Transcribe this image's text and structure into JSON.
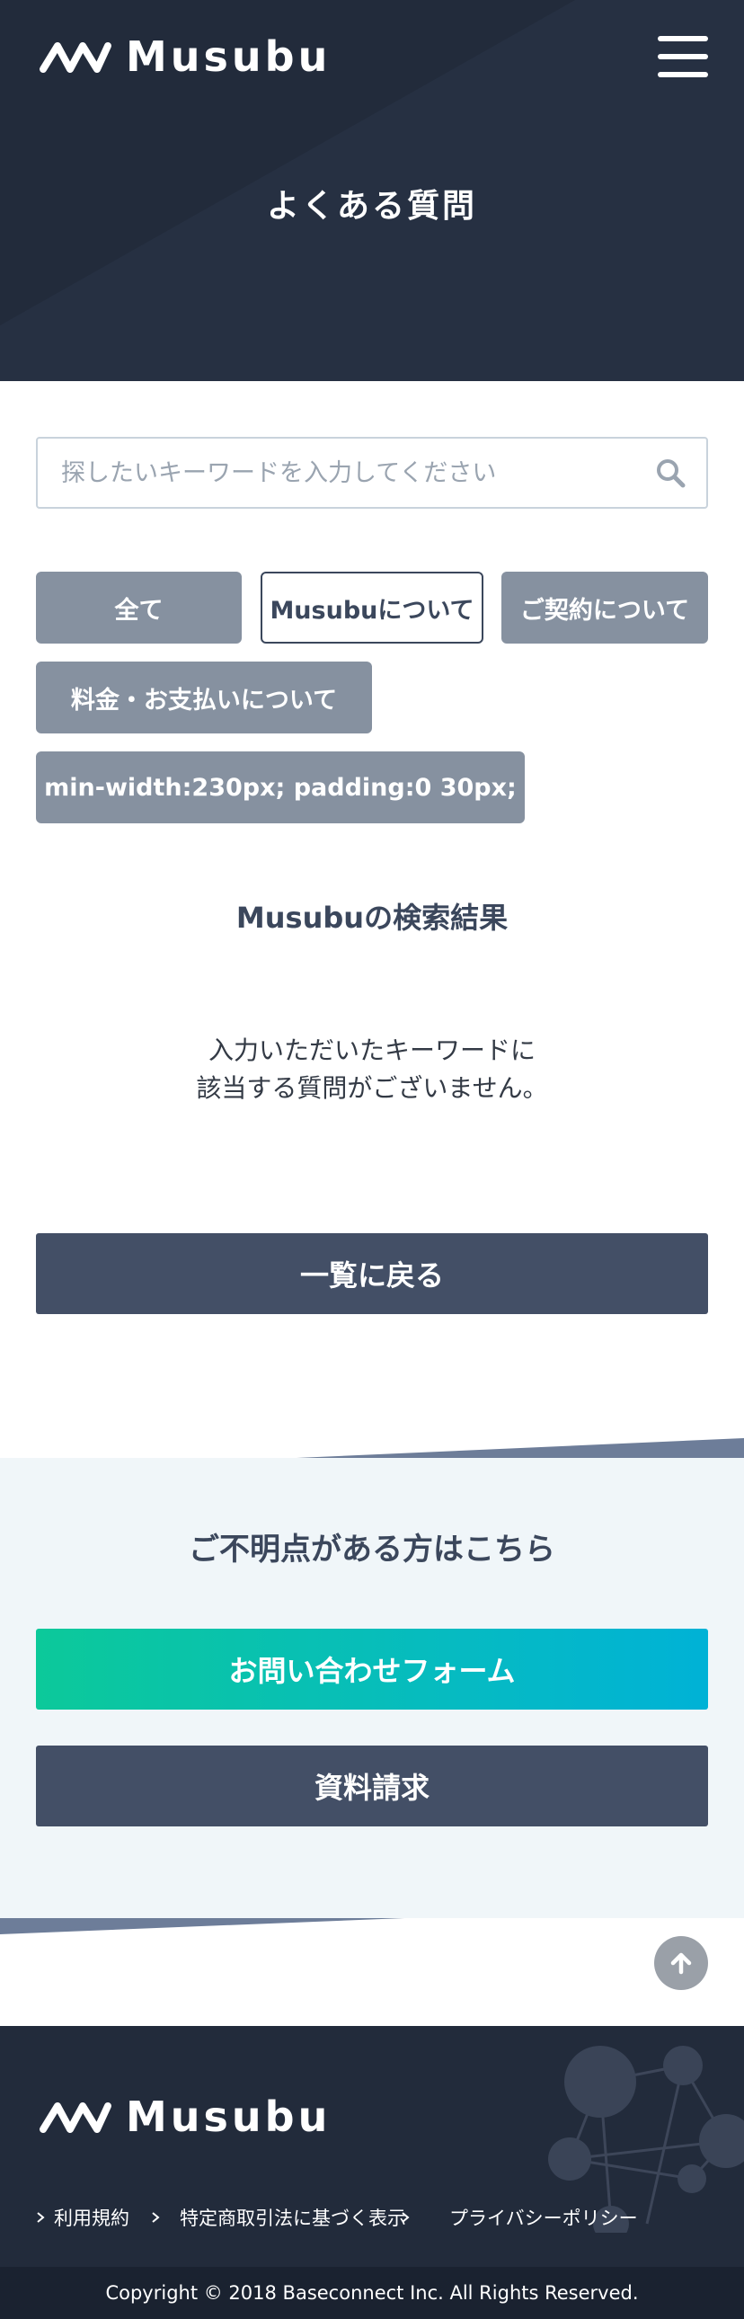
{
  "header": {
    "logo_text": "Musubu",
    "menu_icon": "hamburger-menu-icon",
    "page_title": "よくある質問"
  },
  "search": {
    "placeholder": "探したいキーワードを入力してください",
    "value": "",
    "icon": "search-icon"
  },
  "categories": [
    {
      "label": "全て",
      "active": false
    },
    {
      "label": "Musubuについて",
      "active": true
    },
    {
      "label": "ご契約について",
      "active": false
    },
    {
      "label": "料金・お支払いについて",
      "active": false
    },
    {
      "label": "min-width:230px; padding:0 30px;",
      "active": false
    }
  ],
  "results": {
    "title": "Musubuの検索結果",
    "empty_line1": "入力いただいたキーワードに",
    "empty_line2": "該当する質問がございません。",
    "back_label": "一覧に戻る"
  },
  "contact": {
    "title": "ご不明点がある方はこちら",
    "form_label": "お問い合わせフォーム",
    "doc_label": "資料請求"
  },
  "to_top_icon": "arrow-up-icon",
  "footer": {
    "logo_text": "Musubu",
    "links": [
      {
        "label": "利用規約"
      },
      {
        "label": "特定商取引法に基づく表示"
      },
      {
        "label": "プライバシーポリシー"
      }
    ],
    "copyright": "Copyright © 2018 Baseconnect Inc. All Rights Reserved."
  },
  "colors": {
    "header_bg": "#222b3b",
    "chip_bg": "#8691a0",
    "primary_btn": "#434f66",
    "contact_bg": "#f0f6f9",
    "accent_gradient_start": "#0cc99a",
    "accent_gradient_end": "#00b2d6"
  }
}
